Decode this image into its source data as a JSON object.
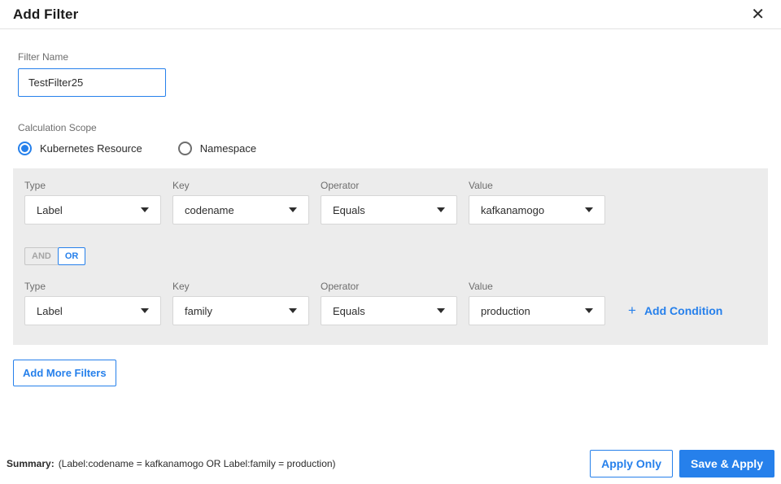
{
  "header": {
    "title": "Add Filter",
    "close_icon": "✕"
  },
  "filter_name": {
    "label": "Filter Name",
    "value": "TestFilter25"
  },
  "calculation_scope": {
    "label": "Calculation Scope",
    "options": [
      {
        "label": "Kubernetes Resource",
        "selected": true
      },
      {
        "label": "Namespace",
        "selected": false
      }
    ]
  },
  "conditions": {
    "columns": [
      "Type",
      "Key",
      "Operator",
      "Value"
    ],
    "rows": [
      {
        "type": "Label",
        "key": "codename",
        "operator": "Equals",
        "value": "kafkanamogo"
      },
      {
        "type": "Label",
        "key": "family",
        "operator": "Equals",
        "value": "production"
      }
    ],
    "logic_toggle": {
      "and_label": "AND",
      "or_label": "OR",
      "selected": "OR"
    },
    "add_condition": {
      "plus_icon": "+",
      "label": "Add Condition"
    }
  },
  "add_more_filters_label": "Add More Filters",
  "footer": {
    "summary_label": "Summary:",
    "summary_text": "(Label:codename = kafkanamogo OR Label:family = production)",
    "apply_only_label": "Apply Only",
    "save_apply_label": "Save & Apply"
  },
  "colors": {
    "accent_blue": "#2680EB",
    "panel_gray": "#ECECEC"
  }
}
